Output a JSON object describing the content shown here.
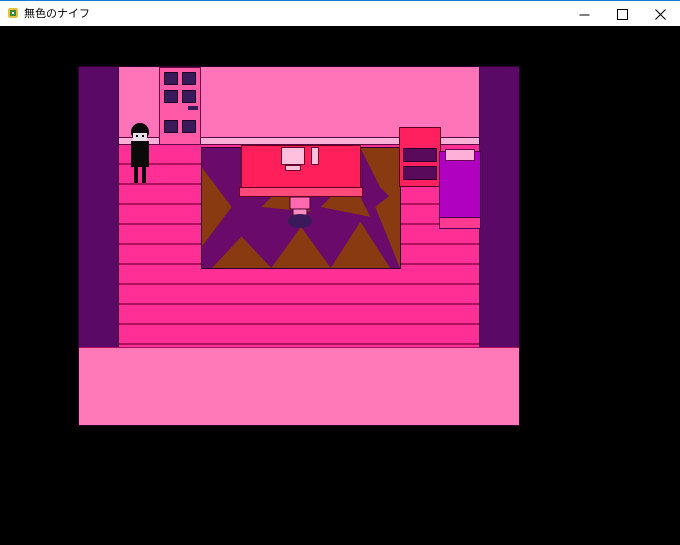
{
  "window": {
    "title": "無色のナイフ",
    "minimize_glyph": "—",
    "maximize_glyph": "☐",
    "close_glyph": "✕"
  },
  "icons": {
    "app": "app-icon",
    "minimize": "minimize-icon",
    "maximize": "maximize-icon",
    "close": "close-icon"
  },
  "colors": {
    "titlebar_bg": "#ffffff",
    "client_bg": "#000000",
    "wall_purple": "#5a0a66",
    "floor_pink": "#ff2f96",
    "back_wall_pink": "#ff74b8",
    "desk_red": "#ff1f5a",
    "rug_brown": "#8a3a10",
    "rug_purple": "#6a0a6a",
    "bed_purple": "#b000c0",
    "character_black": "#0a0a0a"
  }
}
